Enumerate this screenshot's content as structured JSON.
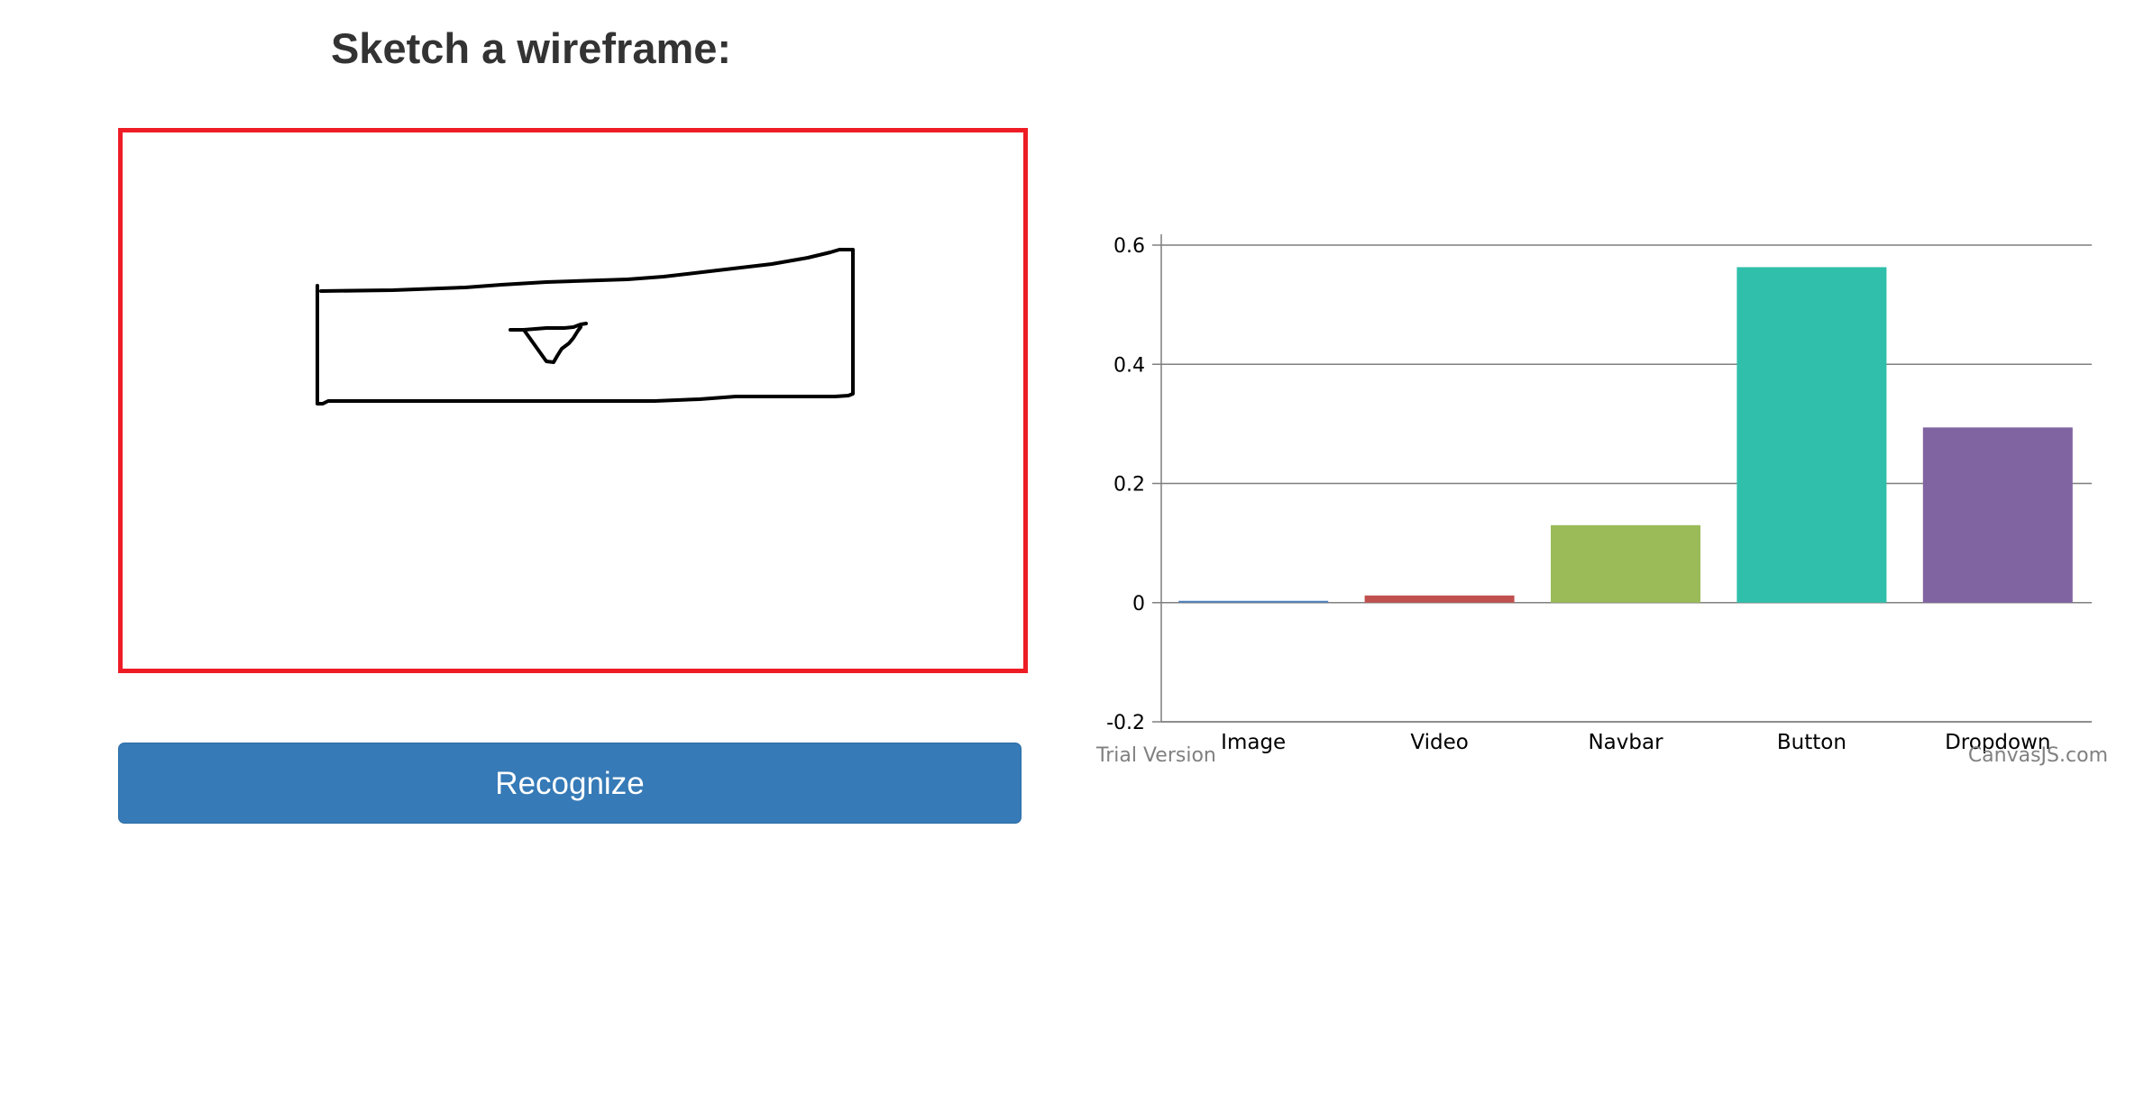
{
  "page": {
    "title": "Sketch a wireframe:"
  },
  "canvas": {
    "border_color": "#ee1c25"
  },
  "actions": {
    "recognize_label": "Recognize",
    "button_color": "#367ab7"
  },
  "chart_data": {
    "type": "bar",
    "categories": [
      "Image",
      "Video",
      "Navbar",
      "Button",
      "Dropdown"
    ],
    "values": [
      0.003,
      0.012,
      0.13,
      0.563,
      0.294
    ],
    "colors": [
      "#4f81bc",
      "#c0504e",
      "#9bbb58",
      "#2fbfaa",
      "#8064a1"
    ],
    "ylim": [
      -0.2,
      0.6
    ],
    "yticks": [
      "0.6",
      "0.4",
      "0.2",
      "0",
      "-0.2"
    ],
    "ytick_values": [
      0.6,
      0.4,
      0.2,
      0,
      -0.2
    ],
    "grid": true,
    "title": "",
    "xlabel": "",
    "ylabel": ""
  },
  "chart_footer": {
    "left": "Trial Version",
    "right": "CanvasJS.com"
  }
}
